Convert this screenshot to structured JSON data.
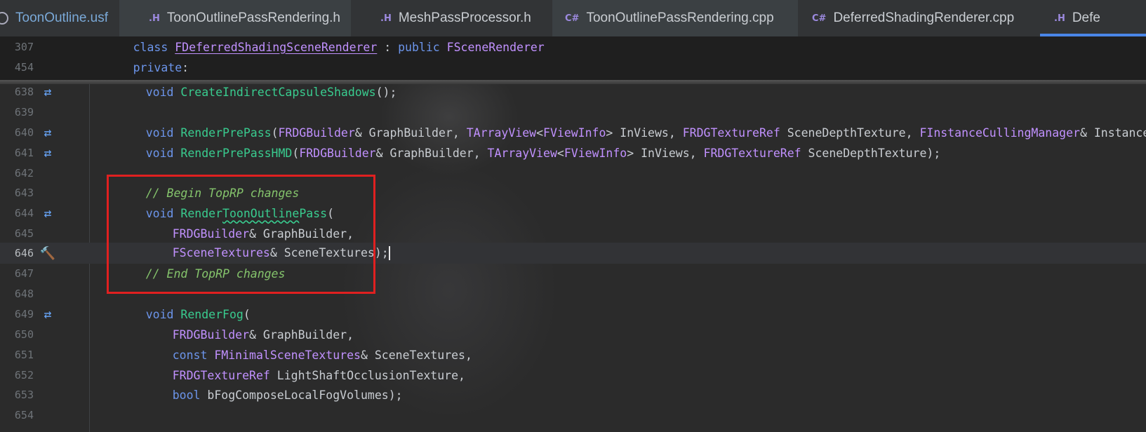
{
  "tabs": [
    {
      "icon": "usf-file-icon",
      "label": "ToonOutline.usf",
      "ext": ""
    },
    {
      "icon": "header-file-icon",
      "label": "ToonOutlinePassRendering.h",
      "ext": ".H"
    },
    {
      "icon": "header-file-icon",
      "label": "MeshPassProcessor.h",
      "ext": ".H"
    },
    {
      "icon": "cpp-file-icon",
      "label": "ToonOutlinePassRendering.cpp",
      "ext": "C#"
    },
    {
      "icon": "cpp-file-icon",
      "label": "DeferredShadingRenderer.cpp",
      "ext": "C#"
    },
    {
      "icon": "header-file-icon",
      "label": "Defe",
      "ext": ".H"
    }
  ],
  "sticky": {
    "l307": {
      "num": "307",
      "kw1": "class ",
      "ty": "FDeferredShadingSceneRenderer",
      "p1": " : ",
      "kw2": "public ",
      "ty2": "FSceneRenderer"
    },
    "l454": {
      "num": "454",
      "kw": "private",
      "p": ":"
    }
  },
  "lines": {
    "l638": {
      "num": "638",
      "kw": "void ",
      "fn": "CreateIndirectCapsuleShadows",
      "p": "();"
    },
    "l639": {
      "num": "639"
    },
    "l640": {
      "num": "640",
      "kw": "void ",
      "fn": "RenderPrePass",
      "p1": "(",
      "t1": "FRDGBuilder",
      "p2": "& GraphBuilder, ",
      "t2": "TArrayView",
      "p3": "<",
      "t3": "FViewInfo",
      "p4": "> InViews, ",
      "t4": "FRDGTextureRef",
      "p5": " SceneDepthTexture, ",
      "t5": "FInstanceCullingManager",
      "p6": "& InstanceCu"
    },
    "l641": {
      "num": "641",
      "kw": "void ",
      "fn": "RenderPrePassHMD",
      "p1": "(",
      "t1": "FRDGBuilder",
      "p2": "& GraphBuilder, ",
      "t2": "TArrayView",
      "p3": "<",
      "t3": "FViewInfo",
      "p4": "> InViews, ",
      "t4": "FRDGTextureRef",
      "p5": " SceneDepthTexture);"
    },
    "l642": {
      "num": "642"
    },
    "l643": {
      "num": "643",
      "cm": "// Begin TopRP changes"
    },
    "l644": {
      "num": "644",
      "kw": "void ",
      "fn1": "Render",
      "fn2": "ToonOutline",
      "fn3": "Pass",
      "p": "("
    },
    "l645": {
      "num": "645",
      "t": "FRDGBuilder",
      "p": "& GraphBuilder,"
    },
    "l646": {
      "num": "646",
      "t": "FSceneTextures",
      "p": "& SceneTextures);"
    },
    "l647": {
      "num": "647",
      "cm": "// End TopRP changes"
    },
    "l648": {
      "num": "648"
    },
    "l649": {
      "num": "649",
      "kw": "void ",
      "fn": "RenderFog",
      "p": "("
    },
    "l650": {
      "num": "650",
      "t": "FRDGBuilder",
      "p": "& GraphBuilder,"
    },
    "l651": {
      "num": "651",
      "kw": "const ",
      "t": "FMinimalSceneTextures",
      "p": "& SceneTextures,"
    },
    "l652": {
      "num": "652",
      "t": "FRDGTextureRef",
      "p": " LightShaftOcclusionTexture,"
    },
    "l653": {
      "num": "653",
      "kw": "bool ",
      "p": "bFogComposeLocalFogVolumes);"
    },
    "l654": {
      "num": "654"
    }
  },
  "colors": {
    "keyword": "#6c95eb",
    "type": "#c191ff",
    "function": "#39cc8f",
    "comment": "#85c46c",
    "highlight_box": "#e02020",
    "active_tab": "#4a86e8"
  }
}
